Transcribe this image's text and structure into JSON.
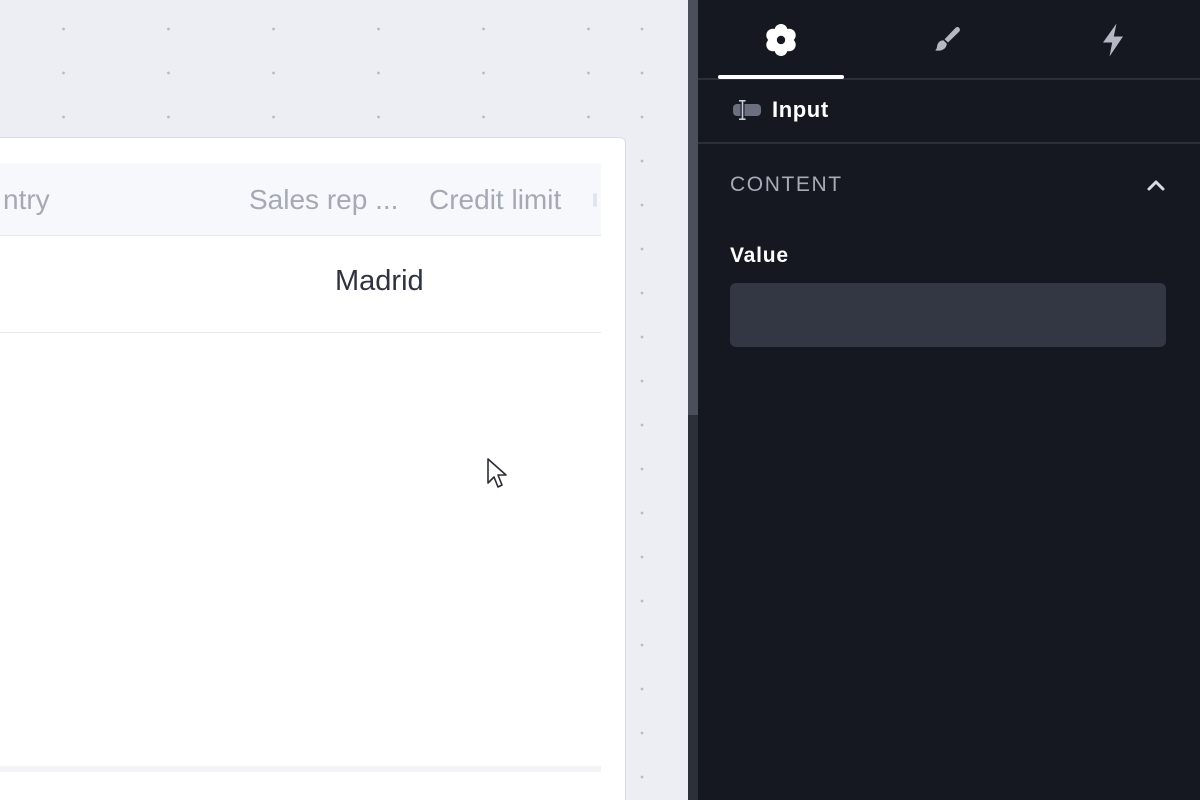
{
  "canvas": {
    "table": {
      "columns": [
        "ntry",
        "Sales rep ...",
        "Credit limit"
      ],
      "rows": [
        {
          "sales_rep": "Madrid"
        }
      ]
    }
  },
  "panel": {
    "tabs": [
      {
        "icon": "gear-icon",
        "active": true
      },
      {
        "icon": "brush-icon",
        "active": false
      },
      {
        "icon": "lightning-icon",
        "active": false
      }
    ],
    "component": {
      "icon": "text-input-icon",
      "name": "Input"
    },
    "section": {
      "title": "CONTENT",
      "collapse_icon": "chevron-up-icon"
    },
    "fields": {
      "value": {
        "label": "Value",
        "current_value": ""
      }
    }
  },
  "colors": {
    "panel_bg": "#151820",
    "canvas_bg": "#edeef3",
    "input_bg": "#323743",
    "muted_text": "#a6abb8"
  }
}
